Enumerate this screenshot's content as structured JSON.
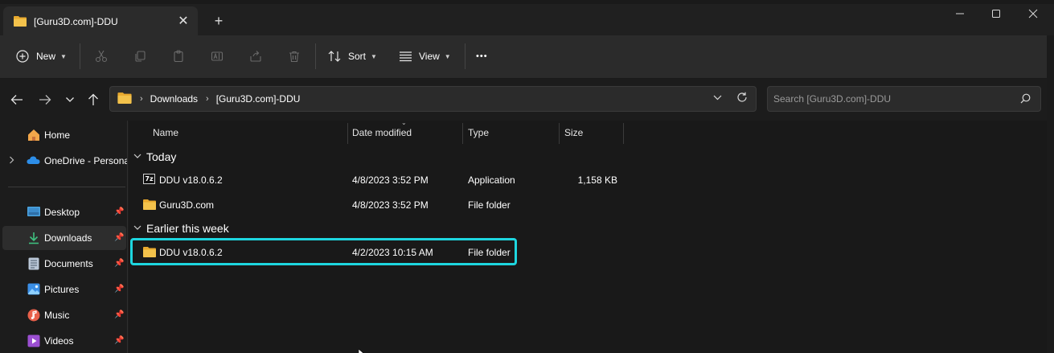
{
  "window": {
    "tab_title": "[Guru3D.com]-DDU",
    "tab_close": "✕",
    "new_tab": "+"
  },
  "toolbar": {
    "new_label": "New",
    "sort_label": "Sort",
    "view_label": "View",
    "more_label": "•••"
  },
  "address": {
    "crumbs": [
      "Downloads",
      "[Guru3D.com]-DDU"
    ],
    "search_placeholder": "Search [Guru3D.com]-DDU"
  },
  "sidebar": {
    "items": [
      {
        "label": "Home",
        "icon": "home-icon"
      },
      {
        "label": "OneDrive - Persona",
        "icon": "onedrive-icon"
      },
      {
        "label": "Desktop",
        "icon": "desktop-icon",
        "pinned": true
      },
      {
        "label": "Downloads",
        "icon": "downloads-icon",
        "pinned": true,
        "active": true
      },
      {
        "label": "Documents",
        "icon": "documents-icon",
        "pinned": true
      },
      {
        "label": "Pictures",
        "icon": "pictures-icon",
        "pinned": true
      },
      {
        "label": "Music",
        "icon": "music-icon",
        "pinned": true
      },
      {
        "label": "Videos",
        "icon": "videos-icon",
        "pinned": true
      }
    ]
  },
  "columns": {
    "name": "Name",
    "date": "Date modified",
    "type": "Type",
    "size": "Size"
  },
  "groups": [
    {
      "label": "Today",
      "files": [
        {
          "name": "DDU v18.0.6.2",
          "date": "4/8/2023 3:52 PM",
          "type": "Application",
          "size": "1,158 KB",
          "icon": "7z-app-icon"
        },
        {
          "name": "Guru3D.com",
          "date": "4/8/2023 3:52 PM",
          "type": "File folder",
          "size": "",
          "icon": "folder-icon"
        }
      ]
    },
    {
      "label": "Earlier this week",
      "files": [
        {
          "name": "DDU v18.0.6.2",
          "date": "4/2/2023 10:15 AM",
          "type": "File folder",
          "size": "",
          "icon": "folder-icon",
          "highlighted": true
        }
      ]
    }
  ],
  "app_icon_text": "7z",
  "colors": {
    "accent_highlight": "#1ed6df",
    "folder_yellow": "#f3c24b",
    "background": "#191919"
  }
}
